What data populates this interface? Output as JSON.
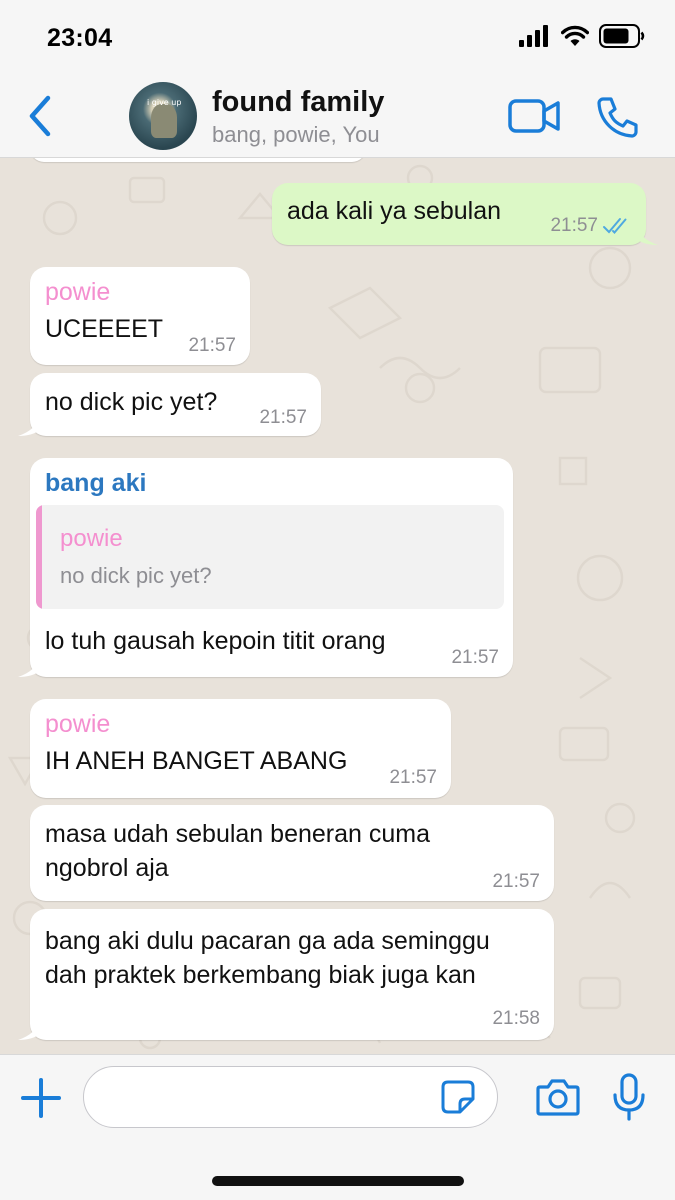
{
  "status_bar": {
    "time": "23:04",
    "icons": [
      "cellular-signal-icon",
      "wifi-icon",
      "battery-icon"
    ]
  },
  "header": {
    "title": "found family",
    "subtitle": "bang, powie, You",
    "avatar_caption": "i give up",
    "icons": [
      "chevron-left-icon",
      "video-camera-icon",
      "phone-icon"
    ]
  },
  "colors": {
    "accent": "#1a7dd8",
    "outgoing_bubble": "#dcf8c6",
    "incoming_bubble": "#ffffff",
    "chat_background": "#e8e2da",
    "powie_name": "#f48fcf",
    "bang_aki_name": "#2c78c0",
    "read_ticks": "#4fa9e0"
  },
  "messages": [
    {
      "text": "ada kali ya sebulan",
      "time": "21:57",
      "direction": "outgoing",
      "read": true
    },
    {
      "sender": "powie",
      "text": "UCEEEET",
      "time": "21:57",
      "direction": "incoming"
    },
    {
      "text": "no dick pic yet?",
      "time": "21:57",
      "direction": "incoming"
    },
    {
      "sender": "bang aki",
      "quote": {
        "sender": "powie",
        "text": "no dick pic yet?"
      },
      "text": "lo tuh gausah kepoin titit orang",
      "time": "21:57",
      "direction": "incoming"
    },
    {
      "sender": "powie",
      "text": "IH ANEH BANGET ABANG",
      "time": "21:57",
      "direction": "incoming"
    },
    {
      "lines": [
        "masa udah sebulan beneran cuma",
        "ngobrol aja"
      ],
      "time": "21:57",
      "direction": "incoming"
    },
    {
      "lines": [
        "bang aki dulu pacaran ga ada seminggu",
        "dah praktek berkembang biak juga kan"
      ],
      "time": "21:58",
      "direction": "incoming"
    }
  ],
  "input_bar": {
    "value": "",
    "icons": [
      "plus-icon",
      "sticker-icon",
      "camera-icon",
      "microphone-icon"
    ]
  }
}
